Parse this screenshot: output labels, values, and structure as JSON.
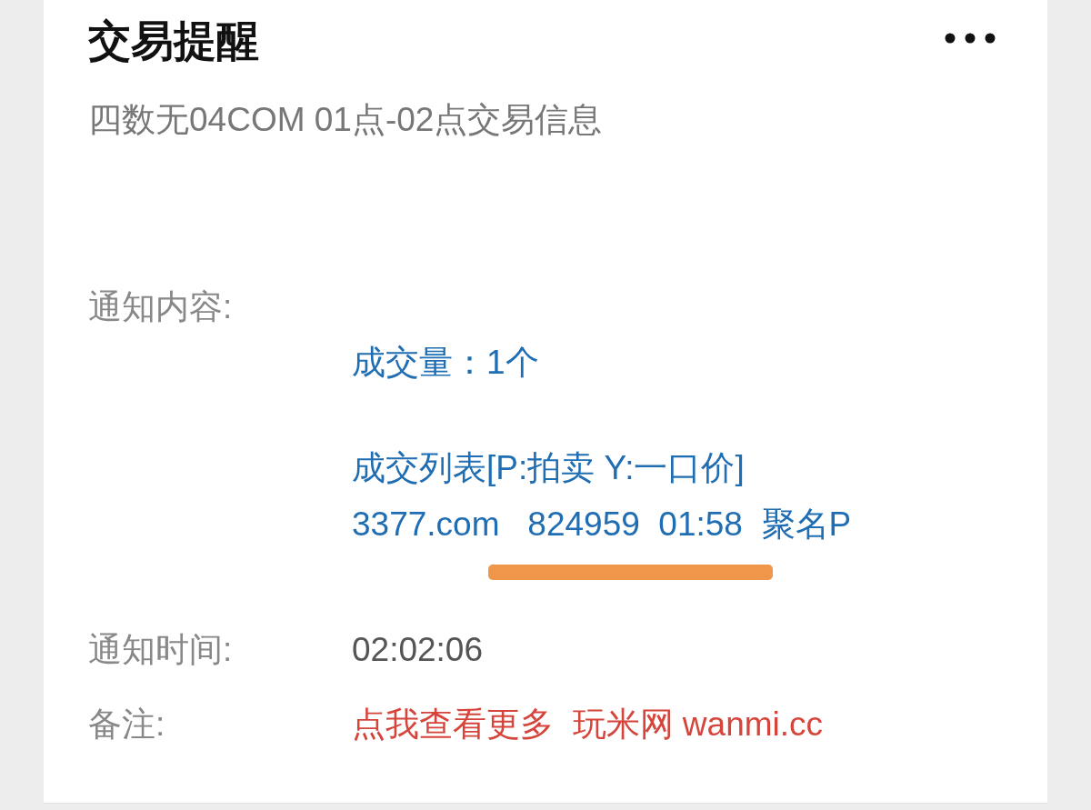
{
  "header": {
    "title": "交易提醒"
  },
  "subtitle": "四数无04COM 01点-02点交易信息",
  "fields": [
    {
      "kind": "block",
      "label": "通知内容:",
      "groups": [
        [
          "成交量：1个"
        ],
        [
          "成交列表[P:拍卖 Y:一口价]",
          "3377.com   824959  01:58  聚名P"
        ]
      ]
    },
    {
      "kind": "plain",
      "label": "通知时间:",
      "value": "02:02:06"
    },
    {
      "kind": "link",
      "label": "备注:",
      "value": "点我查看更多  玩米网 wanmi.cc"
    }
  ]
}
